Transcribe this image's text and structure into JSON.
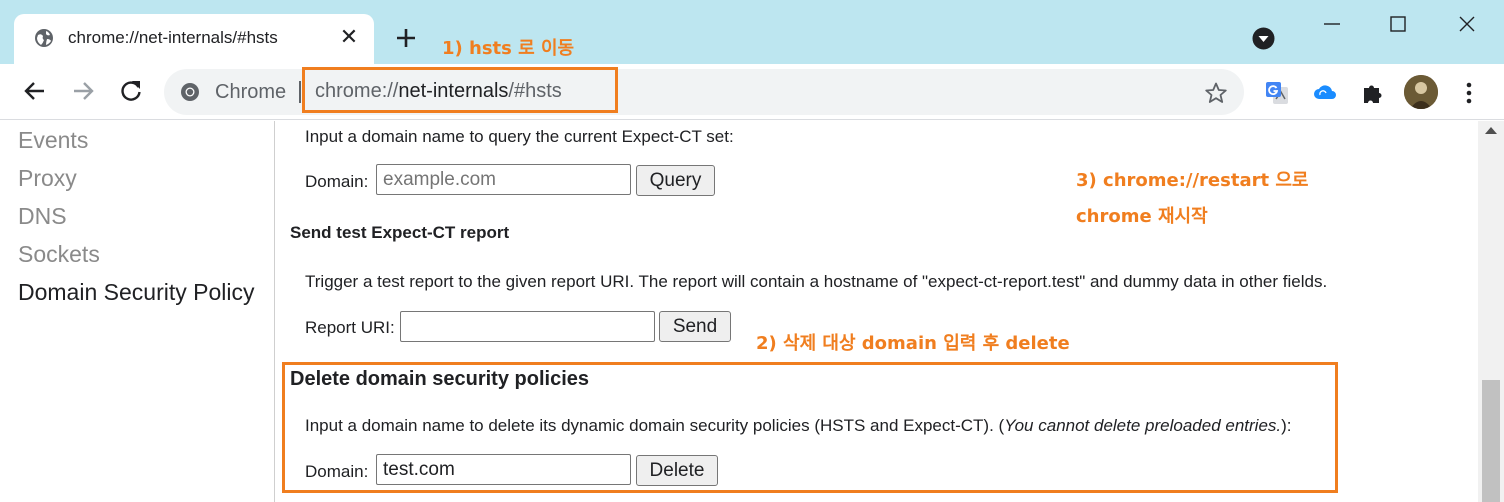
{
  "tab": {
    "title": "chrome://net-internals/#hsts",
    "close_label": "✕"
  },
  "toolbar": {
    "chip_label": "Chrome",
    "url_scheme": "chrome://",
    "url_host": "net-internals",
    "url_path": "/#hsts"
  },
  "annotations": {
    "step1": "1) hsts 로 이동",
    "step2": "2) 삭제 대상 domain 입력 후 delete",
    "step3_line1": "3) chrome://restart 으로",
    "step3_line2": "chrome 재시작",
    "color": "#f07e1f"
  },
  "sidebar": {
    "items": [
      {
        "label": "Events",
        "active": false
      },
      {
        "label": "Proxy",
        "active": false
      },
      {
        "label": "DNS",
        "active": false
      },
      {
        "label": "Sockets",
        "active": false
      },
      {
        "label": "Domain Security Policy",
        "active": true
      }
    ]
  },
  "main": {
    "query_ct": {
      "description": "Input a domain name to query the current Expect-CT set:",
      "domain_label": "Domain:",
      "domain_placeholder": "example.com",
      "button_label": "Query"
    },
    "send_test": {
      "heading": "Send test Expect-CT report",
      "description": "Trigger a test report to the given report URI. The report will contain a hostname of \"expect-ct-report.test\" and dummy data in other fields.",
      "uri_label": "Report URI:",
      "uri_value": "",
      "button_label": "Send"
    },
    "delete_policies": {
      "heading": "Delete domain security policies",
      "description_start": "Input a domain name to delete its dynamic domain security policies (HSTS and Expect-CT). (",
      "description_italic": "You cannot delete preloaded entries.",
      "description_end": "):",
      "domain_label": "Domain:",
      "domain_value": "test.com",
      "button_label": "Delete"
    }
  },
  "icons": {
    "tab_favicon": "globe-icon",
    "new_tab": "plus-icon",
    "tab_search": "tab-search-icon",
    "back": "arrow-left-icon",
    "forward": "arrow-right-icon",
    "reload": "reload-icon",
    "site_info": "chrome-logo-icon",
    "bookmark": "star-icon",
    "extensions": [
      "google-translate-icon",
      "cloud-icon",
      "puzzle-icon"
    ],
    "menu": "kebab-menu-icon"
  },
  "colors": {
    "tab_strip": "#bde6f0",
    "highlight": "#f07e1f"
  }
}
